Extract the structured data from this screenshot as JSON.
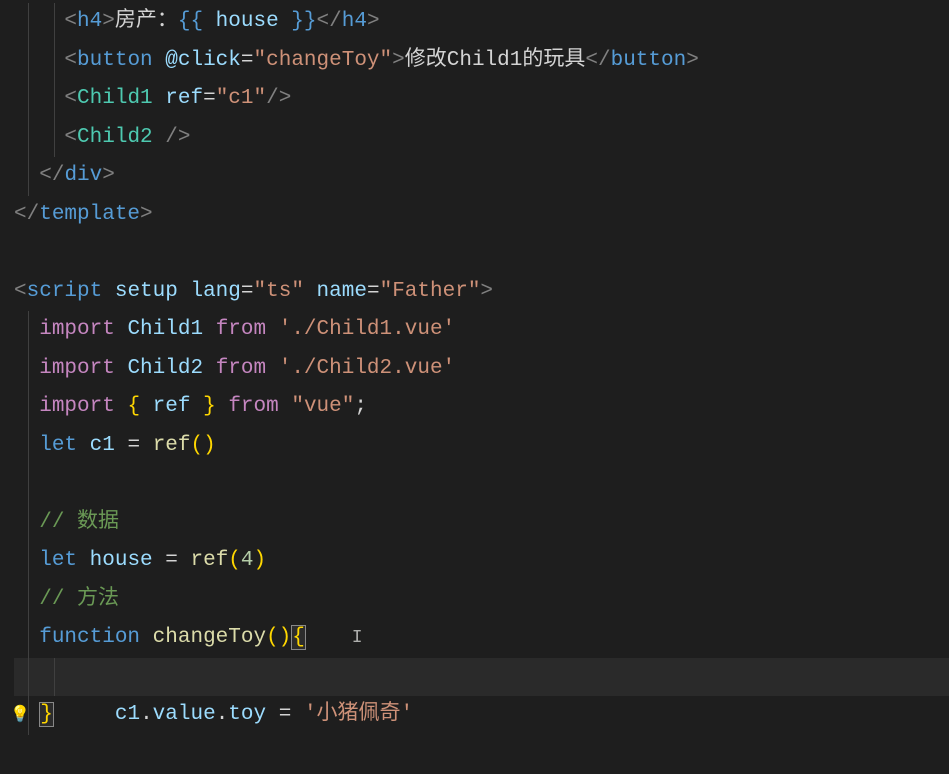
{
  "code": {
    "l1": {
      "tag": "h4",
      "text1": "房产：",
      "expr_open": "{{ ",
      "var": "house",
      "expr_close": " }}"
    },
    "l2": {
      "tag": "button",
      "attr": "@click",
      "val": "changeToy",
      "inner": "修改Child1的玩具"
    },
    "l3": {
      "comp": "Child1",
      "attr": "ref",
      "val": "c1"
    },
    "l4": {
      "comp": "Child2"
    },
    "l5": {
      "tag": "div"
    },
    "l6": {
      "tag": "template"
    },
    "l8": {
      "tag": "script",
      "a1": "setup",
      "a2": "lang",
      "v2": "ts",
      "a3": "name",
      "v3": "Father"
    },
    "l9": {
      "kw1": "import",
      "id": "Child1",
      "kw2": "from",
      "str": "'./Child1.vue'"
    },
    "l10": {
      "kw1": "import",
      "id": "Child2",
      "kw2": "from",
      "str": "'./Child2.vue'"
    },
    "l11": {
      "kw1": "import",
      "id": "ref",
      "kw2": "from",
      "str": "\"vue\""
    },
    "l12": {
      "kw": "let",
      "id": "c1",
      "fn": "ref"
    },
    "l14": {
      "cmt": "// 数据"
    },
    "l15": {
      "kw": "let",
      "id": "house",
      "fn": "ref",
      "arg": "4"
    },
    "l16": {
      "cmt": "// 方法"
    },
    "l17": {
      "kw": "function",
      "fn": "changeToy"
    },
    "l18": {
      "obj": "c1",
      "p1": "value",
      "p2": "toy",
      "str": "'小猪佩奇'"
    }
  }
}
